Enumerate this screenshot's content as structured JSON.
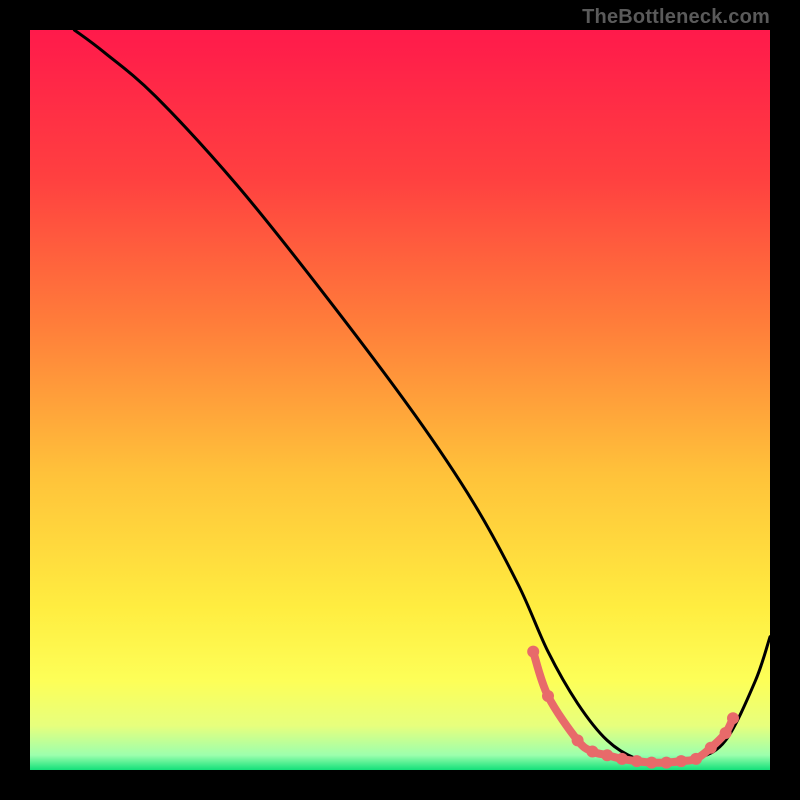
{
  "watermark": "TheBottleneck.com",
  "chart_data": {
    "type": "line",
    "title": "",
    "xlabel": "",
    "ylabel": "",
    "xlim": [
      0,
      100
    ],
    "ylim": [
      0,
      100
    ],
    "grid": false,
    "legend": false,
    "gradient_stops": [
      {
        "offset": 0,
        "color": "#ff1a4b"
      },
      {
        "offset": 20,
        "color": "#ff4040"
      },
      {
        "offset": 40,
        "color": "#ff7e3a"
      },
      {
        "offset": 60,
        "color": "#ffc23a"
      },
      {
        "offset": 78,
        "color": "#ffed40"
      },
      {
        "offset": 88,
        "color": "#fdff58"
      },
      {
        "offset": 94,
        "color": "#e7ff7d"
      },
      {
        "offset": 98,
        "color": "#9cffad"
      },
      {
        "offset": 100,
        "color": "#13e07a"
      }
    ],
    "series": [
      {
        "name": "bottleneck-curve",
        "color": "#000000",
        "x": [
          6,
          10,
          17,
          28,
          40,
          52,
          60,
          66,
          70,
          74,
          78,
          82,
          86,
          90,
          94,
          98,
          100
        ],
        "values": [
          100,
          97,
          91,
          79,
          64,
          48,
          36,
          25,
          16,
          9,
          4,
          1.5,
          1,
          1.5,
          4,
          12,
          18
        ]
      }
    ],
    "markers": {
      "name": "fit-region-markers",
      "color": "#e86a6a",
      "x": [
        68,
        70,
        74,
        76,
        78,
        80,
        82,
        84,
        86,
        88,
        90,
        92,
        94,
        95
      ],
      "values": [
        16,
        10,
        4,
        2.5,
        2,
        1.5,
        1.2,
        1,
        1,
        1.2,
        1.5,
        3,
        5,
        7
      ]
    }
  }
}
